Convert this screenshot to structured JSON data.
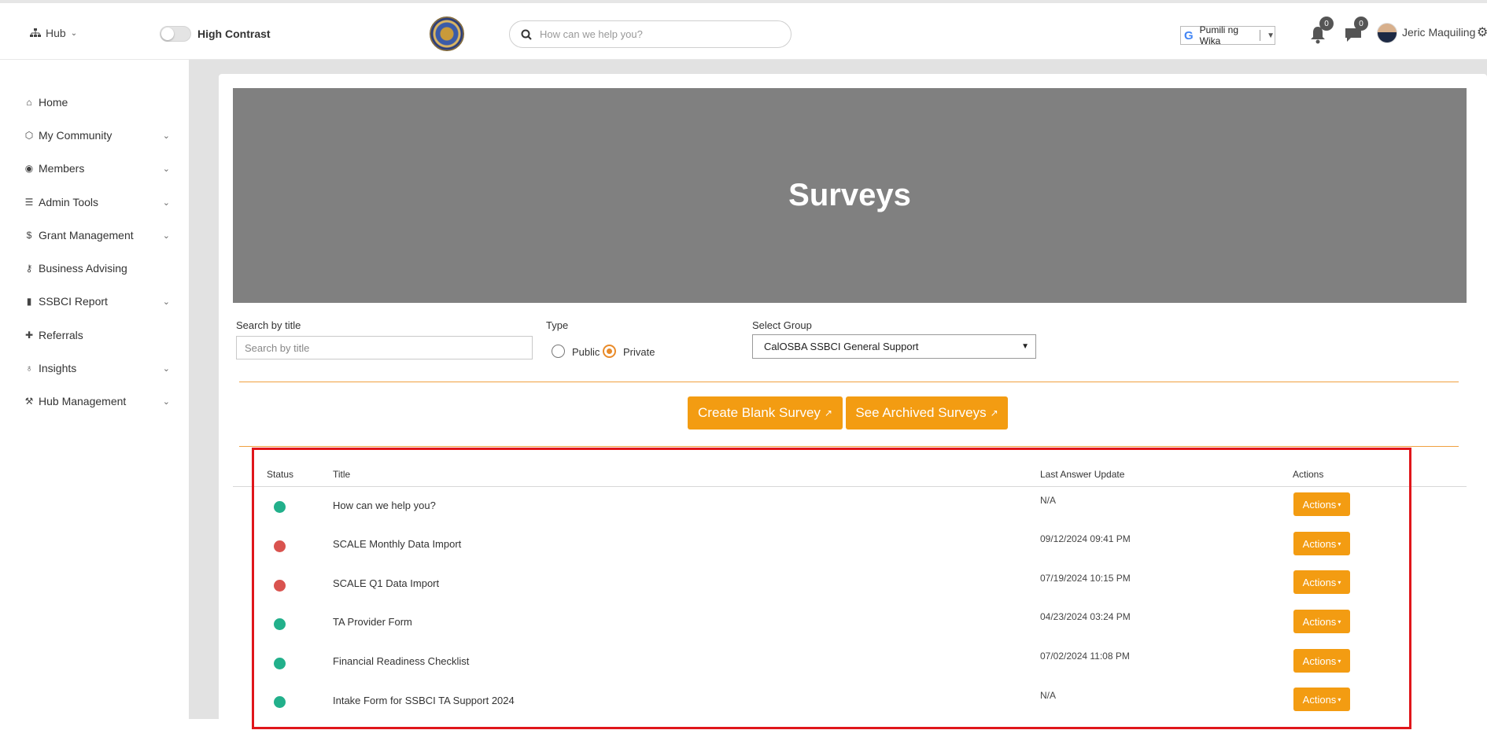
{
  "header": {
    "hub_label": "Hub",
    "high_contrast_label": "High Contrast",
    "search_placeholder": "How can we help you?",
    "language_label": "Pumili ng Wika",
    "notifications_count": "0",
    "messages_count": "0",
    "user_name": "Jeric Maquiling"
  },
  "sidebar": {
    "items": [
      {
        "label": "Home",
        "icon": "home-icon",
        "has_chevron": false
      },
      {
        "label": "My Community",
        "icon": "community-icon",
        "has_chevron": true
      },
      {
        "label": "Members",
        "icon": "user-circle-icon",
        "has_chevron": true
      },
      {
        "label": "Admin Tools",
        "icon": "server-icon",
        "has_chevron": true
      },
      {
        "label": "Grant Management",
        "icon": "dollar-icon",
        "has_chevron": true
      },
      {
        "label": "Business Advising",
        "icon": "key-icon",
        "has_chevron": false
      },
      {
        "label": "SSBCI Report",
        "icon": "file-icon",
        "has_chevron": true
      },
      {
        "label": "Referrals",
        "icon": "user-plus-icon",
        "has_chevron": false
      },
      {
        "label": "Insights",
        "icon": "lightbulb-icon",
        "has_chevron": true
      },
      {
        "label": "Hub Management",
        "icon": "wrench-icon",
        "has_chevron": true
      }
    ]
  },
  "main": {
    "title": "Surveys",
    "search_label": "Search by title",
    "search_placeholder": "Search by title",
    "type_label": "Type",
    "type_options": [
      "Public",
      "Private"
    ],
    "type_selected": "Private",
    "group_label": "Select Group",
    "group_selected": "CalOSBA SSBCI General Support",
    "create_button": "Create Blank Survey",
    "archived_button": "See Archived Surveys",
    "button_arrow": "↗"
  },
  "table": {
    "columns": [
      "Status",
      "Title",
      "Last Answer Update",
      "Actions"
    ],
    "rows": [
      {
        "status": "active",
        "title": "How can we help you?",
        "last_update": "N/A",
        "action": "Actions"
      },
      {
        "status": "inactive",
        "title": "SCALE Monthly Data Import",
        "last_update": "09/12/2024 09:41 PM",
        "action": "Actions"
      },
      {
        "status": "inactive",
        "title": "SCALE Q1 Data Import",
        "last_update": "07/19/2024 10:15 PM",
        "action": "Actions"
      },
      {
        "status": "active",
        "title": "TA Provider Form",
        "last_update": "04/23/2024 03:24 PM",
        "action": "Actions"
      },
      {
        "status": "active",
        "title": "Financial Readiness Checklist",
        "last_update": "07/02/2024 11:08 PM",
        "action": "Actions"
      },
      {
        "status": "active",
        "title": "Intake Form for SSBCI TA Support 2024",
        "last_update": "N/A",
        "action": "Actions"
      }
    ]
  },
  "colors": {
    "accent_orange": "#f39c12",
    "status_active": "#22b08b",
    "status_inactive": "#d9534f",
    "highlight_box": "#e0161b",
    "hero_bg": "#808080"
  }
}
